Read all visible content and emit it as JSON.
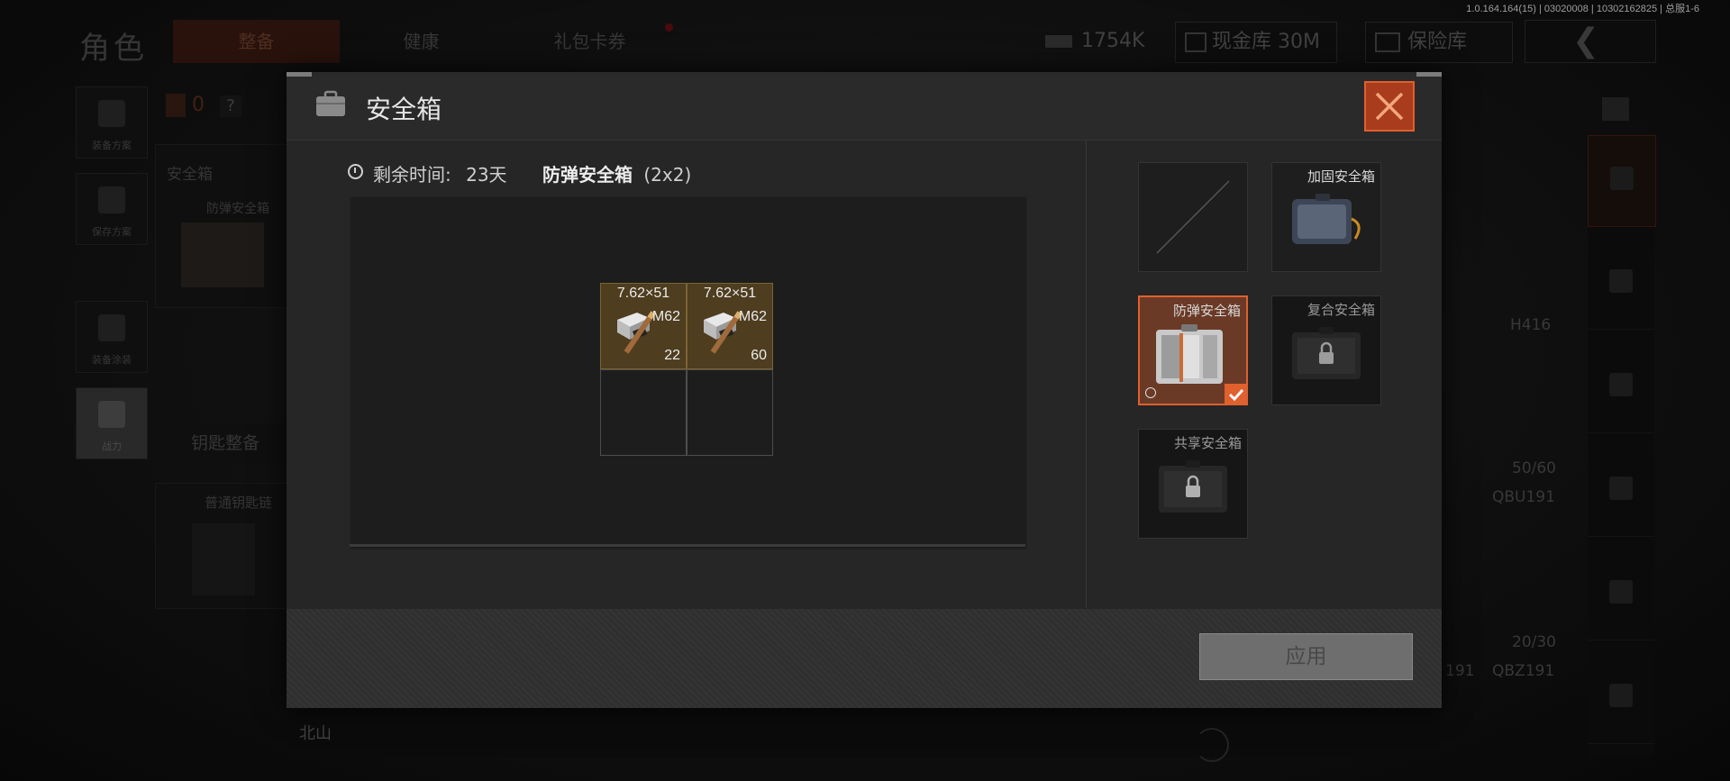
{
  "version": "1.0.164.164(15) | 03020008 | 10302162825 | 总服1-6",
  "background": {
    "page_title": "角色",
    "tabs": [
      "整备",
      "健康",
      "礼包卡券"
    ],
    "currency": {
      "cash": "1754K",
      "vault_cash": "现金库 30M",
      "vault": "保险库"
    },
    "left_buttons": [
      "装备方案",
      "保存方案",
      "装备涂装",
      "战力"
    ],
    "left_panel": {
      "top_counter": "0",
      "section_label": "安全箱",
      "case_name": "防弹安全箱",
      "key_chain_button": "钥匙整备",
      "keychain_name": "普通钥匙链"
    },
    "right_items": [
      {
        "name": "H416",
        "ammo": "50/60"
      },
      {
        "name": "QBU191",
        "ammo": "20/30"
      },
      {
        "name": "QBZ191",
        "extra": "191"
      }
    ],
    "bottom_label": "北山"
  },
  "modal": {
    "title": "安全箱",
    "remaining_label": "剩余时间:",
    "remaining_value": "23天",
    "case_name": "防弹安全箱",
    "case_size": "(2x2)",
    "items": [
      {
        "caliber": "7.62×51",
        "model": "M62",
        "qty": "22"
      },
      {
        "caliber": "7.62×51",
        "model": "M62",
        "qty": "60"
      }
    ],
    "cases": [
      {
        "name": "",
        "state": "empty"
      },
      {
        "name": "加固安全箱",
        "state": "available"
      },
      {
        "name": "防弹安全箱",
        "state": "selected"
      },
      {
        "name": "复合安全箱",
        "state": "locked"
      },
      {
        "name": "共享安全箱",
        "state": "locked"
      }
    ],
    "apply_label": "应用"
  },
  "colors": {
    "accent": "#e0602e",
    "item_bg": "#4e3d1f",
    "modal_bg": "#262626"
  }
}
